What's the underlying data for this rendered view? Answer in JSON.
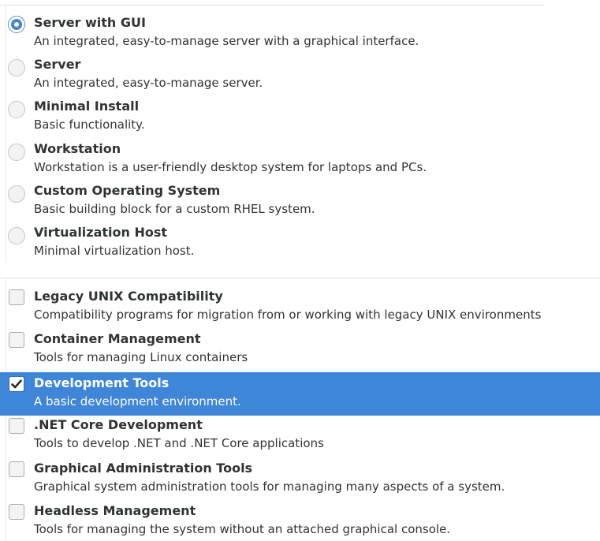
{
  "environments": {
    "items": [
      {
        "title": "Server with GUI",
        "description": "An integrated, easy-to-manage server with a graphical interface.",
        "checked": true
      },
      {
        "title": "Server",
        "description": "An integrated, easy-to-manage server.",
        "checked": false
      },
      {
        "title": "Minimal Install",
        "description": "Basic functionality.",
        "checked": false
      },
      {
        "title": "Workstation",
        "description": "Workstation is a user-friendly desktop system for laptops and PCs.",
        "checked": false
      },
      {
        "title": "Custom Operating System",
        "description": "Basic building block for a custom RHEL system.",
        "checked": false
      },
      {
        "title": "Virtualization Host",
        "description": "Minimal virtualization host.",
        "checked": false
      }
    ]
  },
  "addons": {
    "items": [
      {
        "title": "Legacy UNIX Compatibility",
        "description": "Compatibility programs for migration from or working with legacy UNIX environments",
        "checked": false,
        "selected": false
      },
      {
        "title": "Container Management",
        "description": "Tools for managing Linux containers",
        "checked": false,
        "selected": false
      },
      {
        "title": "Development Tools",
        "description": "A basic development environment.",
        "checked": true,
        "selected": true
      },
      {
        "title": ".NET Core Development",
        "description": "Tools to develop .NET and .NET Core applications",
        "checked": false,
        "selected": false
      },
      {
        "title": "Graphical Administration Tools",
        "description": "Graphical system administration tools for managing many aspects of a system.",
        "checked": false,
        "selected": false
      },
      {
        "title": "Headless Management",
        "description": "Tools for managing the system without an attached graphical console.",
        "checked": false,
        "selected": false
      }
    ]
  },
  "colors": {
    "selection": "#3f86d8",
    "radio_accent": "#4a86cf",
    "text": "#2e3436"
  }
}
